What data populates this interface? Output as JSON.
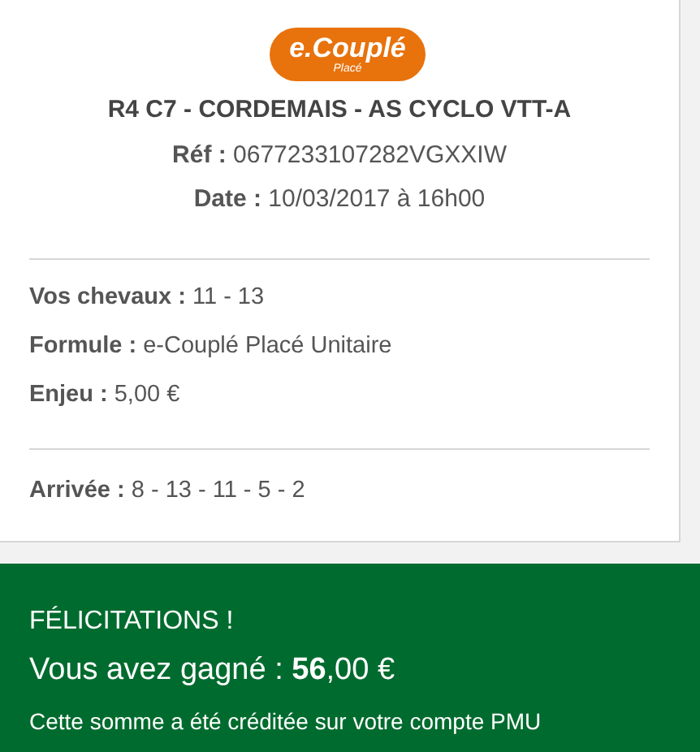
{
  "logo": {
    "main": "e.Couplé",
    "sub": "Placé"
  },
  "header": {
    "race": "R4 C7 - CORDEMAIS - AS CYCLO VTT-A",
    "ref": "**Réf :** 0677233107282VGXXIW",
    "date": "**Date :** 10/03/2017 à 16h00"
  },
  "details": [
    "**Vos chevaux :** 11 - 13",
    "**Formule :** e-Couplé Placé Unitaire",
    "**Enjeu :** 5,00 €"
  ],
  "arrival": "**Arrivée :** 8 - 13 - 11 - 5 - 2",
  "win": {
    "title": "FÉLICITATIONS !",
    "amount": "Vous avez gagné : **56**,00 €",
    "note": "Cette somme a été créditée sur votre compte PMU"
  }
}
